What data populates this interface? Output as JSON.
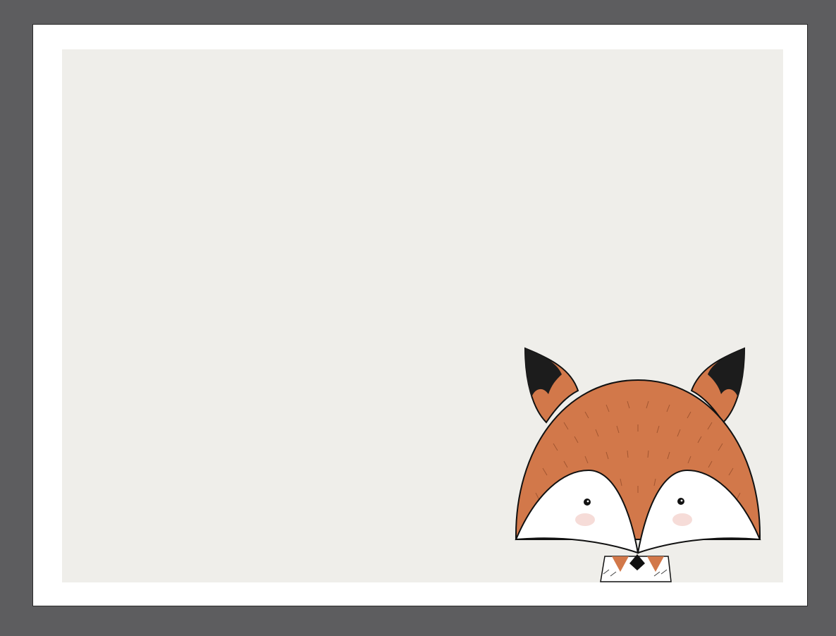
{
  "canvas": {
    "workspace_color": "#5d5d5f",
    "paper_color": "#ffffff",
    "panel_color": "#efeeea"
  },
  "illustration": {
    "subject": "fox-head",
    "colors": {
      "fur": "#d2784a",
      "outline": "#111111",
      "face": "#ffffff",
      "cheek": "#f6dcd8",
      "nose": "#111111"
    }
  }
}
